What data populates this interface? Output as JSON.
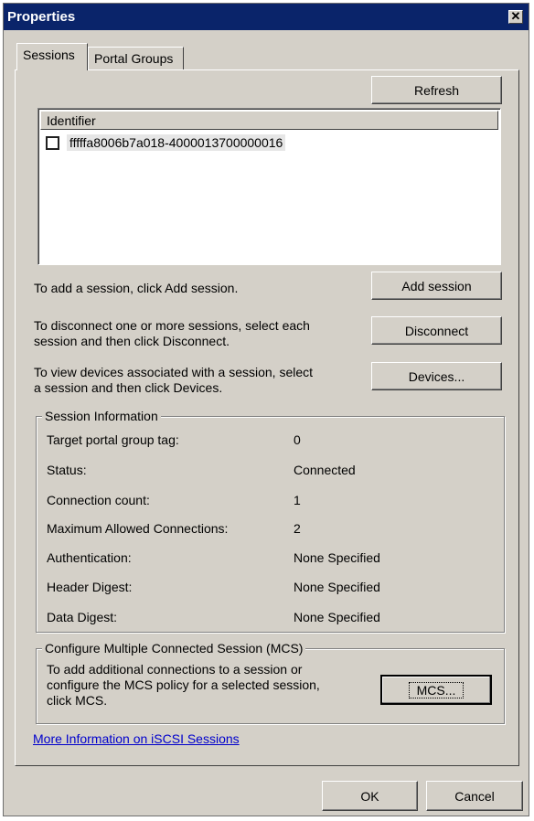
{
  "window": {
    "title": "Properties",
    "close_glyph": "✕"
  },
  "tabs": [
    {
      "label": "Sessions",
      "active": true
    },
    {
      "label": "Portal Groups",
      "active": false
    }
  ],
  "buttons": {
    "refresh": "Refresh",
    "add_session": "Add session",
    "disconnect": "Disconnect",
    "devices": "Devices...",
    "mcs": "MCS...",
    "ok": "OK",
    "cancel": "Cancel"
  },
  "session_list": {
    "column_header": "Identifier",
    "rows": [
      {
        "checked": false,
        "identifier": "fffffa8006b7a018-4000013700000016"
      }
    ]
  },
  "instructions": {
    "add": "To add a session, click Add session.",
    "disconnect_line1": "To disconnect one or more sessions, select each",
    "disconnect_line2": "session and then click Disconnect.",
    "devices_line1": "To view devices associated with a session, select",
    "devices_line2": "a session and then click Devices."
  },
  "session_info": {
    "legend": "Session Information",
    "fields": [
      {
        "label": "Target portal group tag:",
        "value": "0"
      },
      {
        "label": "Status:",
        "value": "Connected"
      },
      {
        "label": "Connection count:",
        "value": "1"
      },
      {
        "label": "Maximum Allowed Connections:",
        "value": "2"
      },
      {
        "label": "Authentication:",
        "value": "None Specified"
      },
      {
        "label": "Header Digest:",
        "value": "None Specified"
      },
      {
        "label": "Data Digest:",
        "value": "None Specified"
      }
    ]
  },
  "mcs": {
    "legend": "Configure Multiple Connected Session (MCS)",
    "line1": "To add additional connections to a session or",
    "line2": "configure the MCS policy for a selected session,",
    "line3": "click MCS."
  },
  "link": {
    "text": "More Information on iSCSI Sessions"
  },
  "colors": {
    "titlebar": "#0a246a",
    "dialog_face": "#d4d0c8",
    "link": "#0000cc"
  }
}
